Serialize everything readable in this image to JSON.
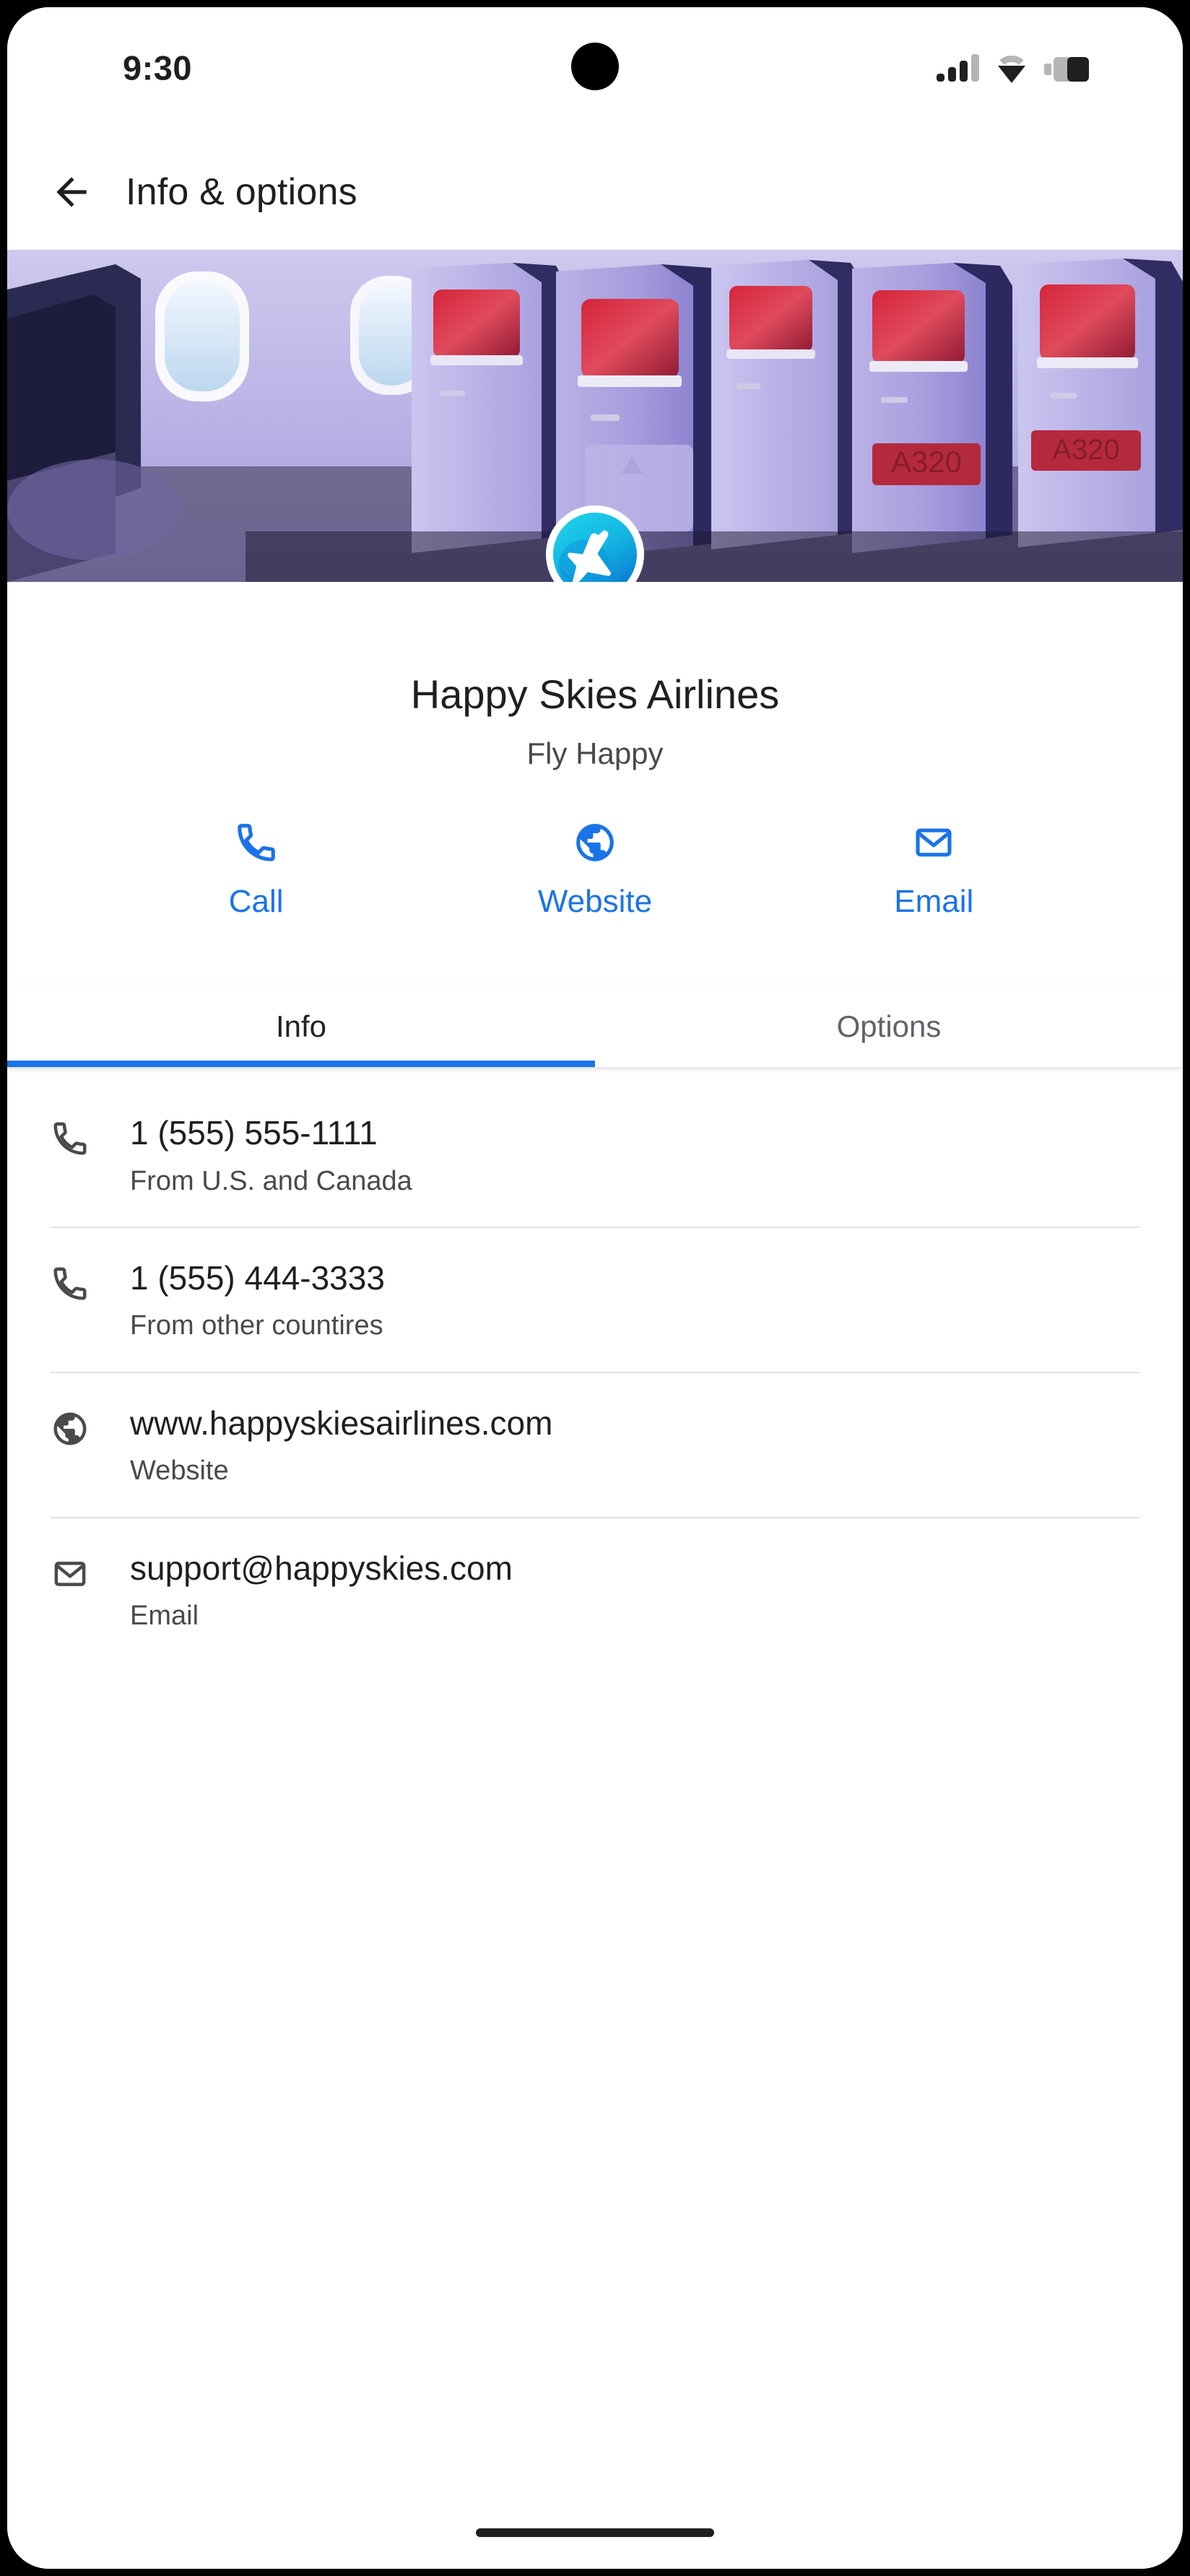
{
  "status_bar": {
    "time": "9:30",
    "signal_icon": "signal-bars-icon",
    "wifi_icon": "wifi-icon",
    "battery_icon": "battery-icon"
  },
  "app_bar": {
    "back_icon": "back-arrow-icon",
    "title": "Info & options"
  },
  "hero": {
    "alt": "airplane-cabin-interior-photo"
  },
  "brand": {
    "logo_icon": "airplane-logo-icon",
    "name": "Happy Skies Airlines",
    "tagline": "Fly Happy"
  },
  "actions": [
    {
      "icon": "phone-icon",
      "label": "Call"
    },
    {
      "icon": "globe-icon",
      "label": "Website"
    },
    {
      "icon": "email-icon",
      "label": "Email"
    }
  ],
  "tabs": [
    {
      "label": "Info",
      "active": true
    },
    {
      "label": "Options",
      "active": false
    }
  ],
  "info_rows": [
    {
      "icon": "phone-icon",
      "primary": "1 (555) 555-1111",
      "secondary": "From U.S. and Canada"
    },
    {
      "icon": "phone-icon",
      "primary": "1 (555) 444-3333",
      "secondary": "From other countires"
    },
    {
      "icon": "globe-icon",
      "primary": "www.happyskiesairlines.com",
      "secondary": "Website"
    },
    {
      "icon": "email-icon",
      "primary": "support@happyskies.com",
      "secondary": "Email"
    }
  ],
  "colors": {
    "accent_blue": "#1a73e8",
    "logo_cyan": "#19c8e8",
    "logo_blue": "#0f86db",
    "text_primary": "#1f1f1f",
    "text_secondary": "#4a4a4a",
    "tab_inactive": "#5f6368"
  },
  "home_indicator": "home-indicator"
}
